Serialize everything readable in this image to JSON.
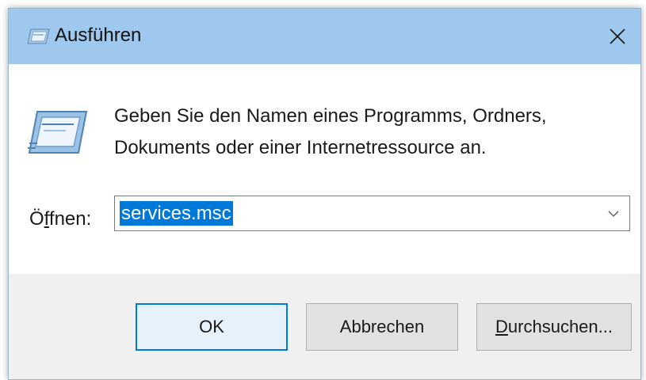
{
  "window": {
    "title": "Ausführen"
  },
  "dialog": {
    "description_line1": "Geben Sie den Namen eines Programms, Ordners,",
    "description_line2": "Dokuments oder einer Internetressource an.",
    "open_label_prefix": "Ö",
    "open_label_accel": "f",
    "open_label_suffix": "fnen:",
    "open_value": "services.msc"
  },
  "buttons": {
    "ok": "OK",
    "cancel": "Abbrechen",
    "browse_accel": "D",
    "browse_rest": "urchsuchen..."
  },
  "icons": {
    "title": "run-icon",
    "close": "close-icon",
    "main": "run-icon",
    "dropdown": "chevron-down-icon"
  },
  "colors": {
    "titlebar": "#9ec8ee",
    "selection": "#0078d7",
    "footer": "#f0f0f0"
  }
}
